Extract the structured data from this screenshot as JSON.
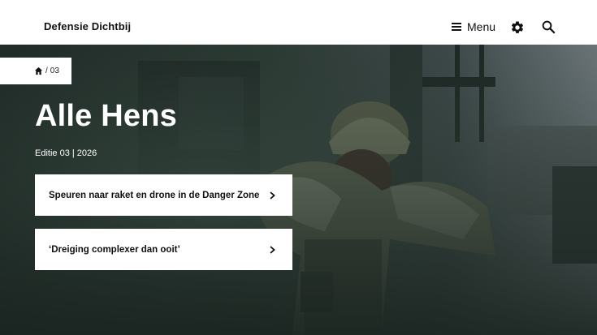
{
  "header": {
    "site_title": "Defensie Dichtbij",
    "menu_label": "Menu",
    "icons": {
      "menu": "hamburger-icon",
      "settings": "gear-icon",
      "search": "search-icon"
    }
  },
  "breadcrumb": {
    "home_icon": "home-icon",
    "separator": "/",
    "current": "03"
  },
  "hero": {
    "title": "Alle Hens",
    "edition": "Editie 03 | 2026",
    "image": "soldier-carrying-person-photo",
    "cards": [
      {
        "label": "Speuren naar raket en drone in de Danger Zone",
        "icon": "chevron-right-icon"
      },
      {
        "label": "‘Dreiging complexer dan ooit’",
        "icon": "chevron-right-icon"
      }
    ]
  },
  "colors": {
    "header_bg": "#ffffff",
    "text_dark": "#111111",
    "hero_text": "#ffffff",
    "card_bg": "#ffffff"
  }
}
